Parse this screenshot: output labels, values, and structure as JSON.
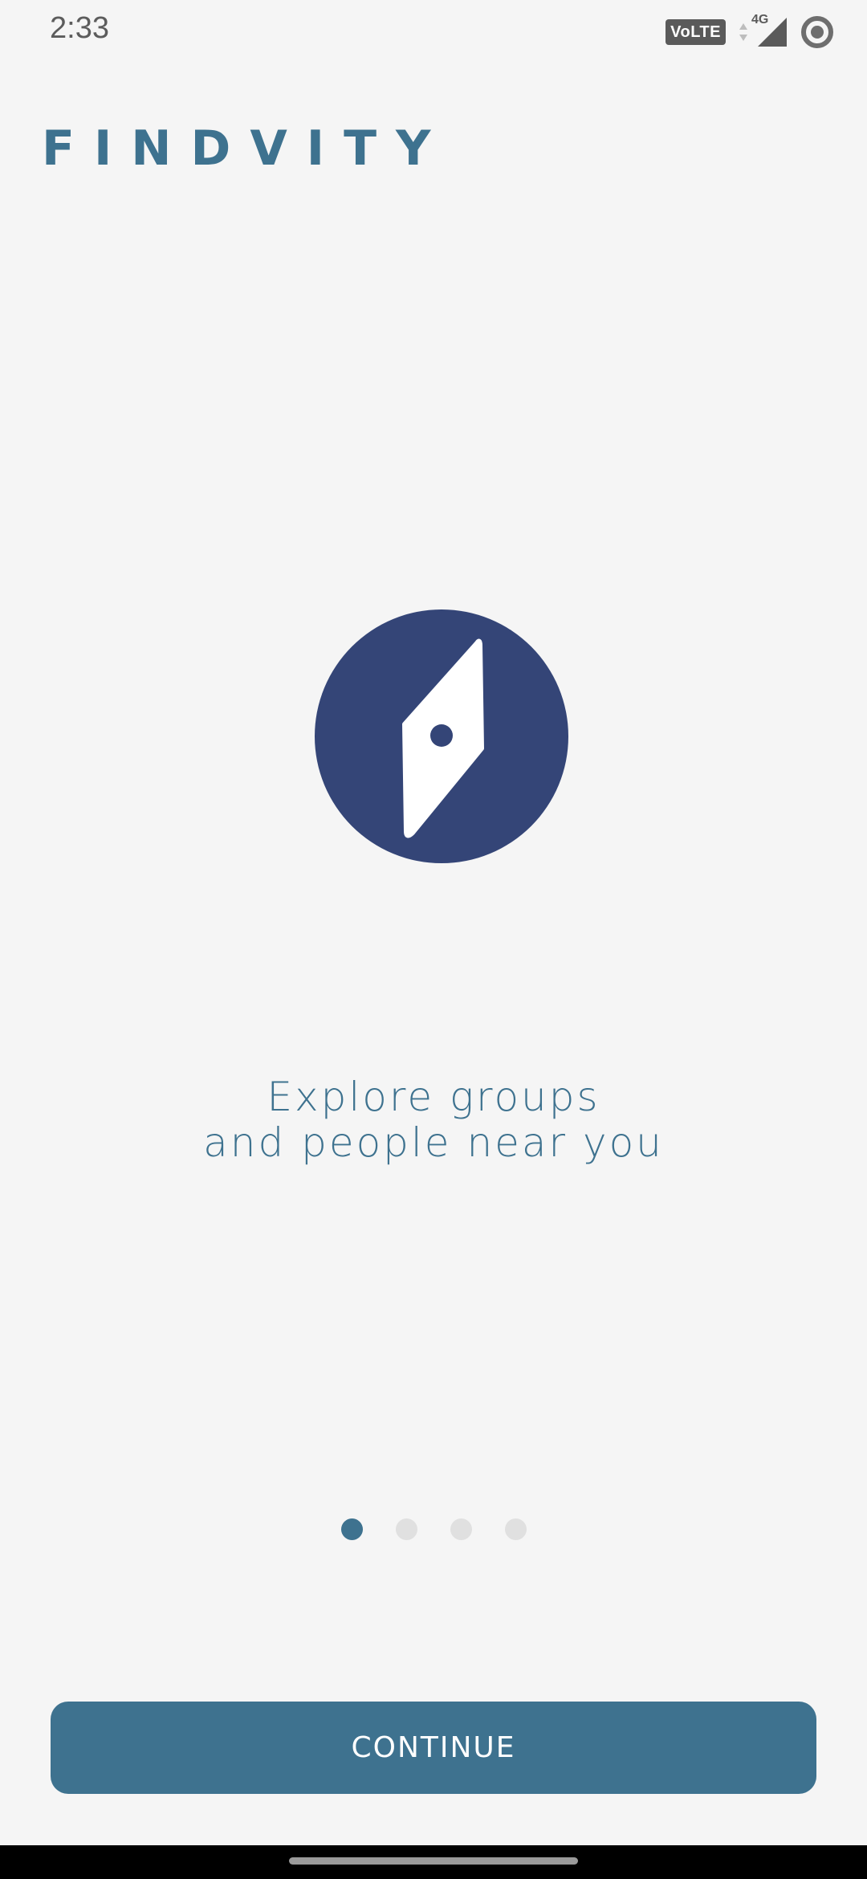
{
  "status_bar": {
    "time": "2:33",
    "volte": "VoLTE",
    "network": "4G",
    "icons": [
      "volte-icon",
      "data-arrows-icon",
      "signal-icon",
      "record-icon"
    ]
  },
  "brand": {
    "name": "FINDVITY"
  },
  "illustration": {
    "icon": "compass-icon",
    "circle_color": "#344577",
    "needle_color": "#ffffff"
  },
  "tagline": {
    "line1": "Explore groups",
    "line2": "and people near you"
  },
  "pager": {
    "total": 4,
    "current": 1
  },
  "actions": {
    "continue_label": "CONTINUE"
  },
  "colors": {
    "primary": "#3e728f",
    "background": "#f5f5f5",
    "dot_inactive": "#e0e0e0"
  }
}
